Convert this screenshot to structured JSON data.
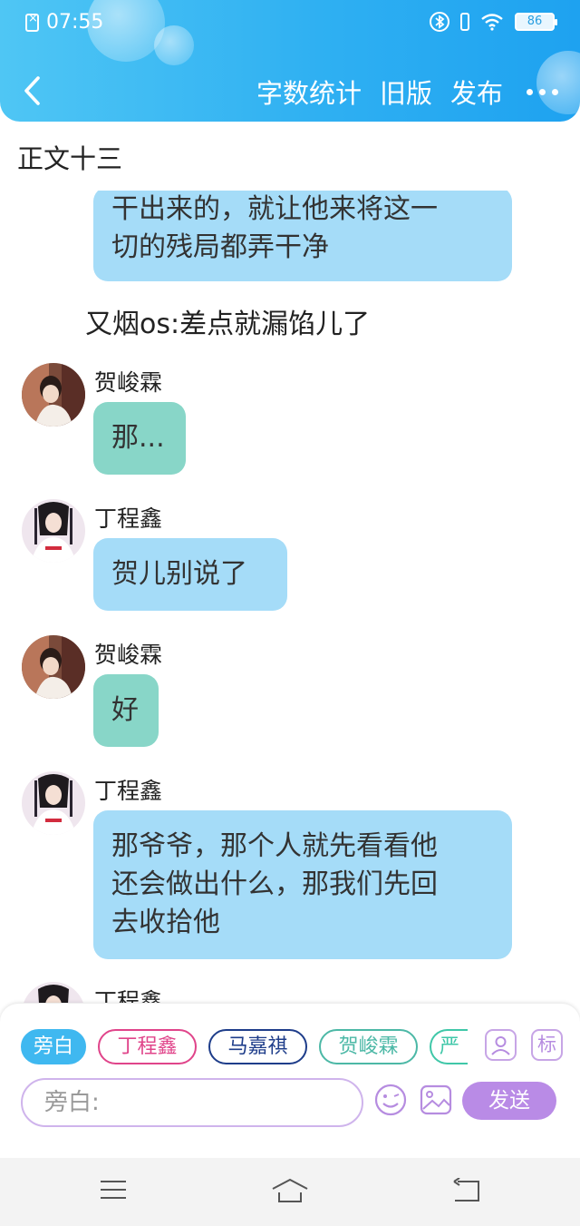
{
  "status_bar": {
    "time": "07:55",
    "battery": "86"
  },
  "header": {
    "actions": {
      "word_count": "字数统计",
      "old_version": "旧版",
      "publish": "发布"
    }
  },
  "chapter_title": "正文十三",
  "messages": [
    {
      "type": "bubble",
      "color": "blue",
      "lines": [
        "干出来的，就让他来将这一",
        "切的残局都弄干净"
      ]
    },
    {
      "type": "narration",
      "text": "又烟os:差点就漏馅儿了"
    },
    {
      "type": "message",
      "speaker": "贺峻霖",
      "color": "teal",
      "lines": [
        "那..."
      ]
    },
    {
      "type": "message",
      "speaker": "丁程鑫",
      "color": "blue",
      "lines": [
        "贺儿别说了"
      ]
    },
    {
      "type": "message",
      "speaker": "贺峻霖",
      "color": "teal",
      "lines": [
        "好"
      ]
    },
    {
      "type": "message",
      "speaker": "丁程鑫",
      "color": "blue",
      "lines": [
        "那爷爷，那个人就先看看他",
        "还会做出什么，那我们先回",
        "去收拾他"
      ]
    },
    {
      "type": "message",
      "speaker": "丁程鑫",
      "color": "blue",
      "lines": []
    }
  ],
  "composer": {
    "characters": [
      {
        "label": "旁白",
        "color": "#3fb8f0",
        "selected": true
      },
      {
        "label": "丁程鑫",
        "color": "#e0448a",
        "selected": false
      },
      {
        "label": "马嘉祺",
        "color": "#1e3d8a",
        "selected": false
      },
      {
        "label": "贺峻霖",
        "color": "#4cb8a6",
        "selected": false
      },
      {
        "label": "严",
        "color": "#3fc7a8",
        "selected": false
      }
    ],
    "label_button": "标",
    "input_placeholder": "旁白:",
    "send_label": "发送"
  },
  "colors": {
    "header_gradient_start": "#4fc6f4",
    "header_gradient_end": "#1ea2f0",
    "bubble_blue": "#a5dcf8",
    "bubble_teal": "#88d6c8",
    "accent_purple": "#b98be6"
  }
}
